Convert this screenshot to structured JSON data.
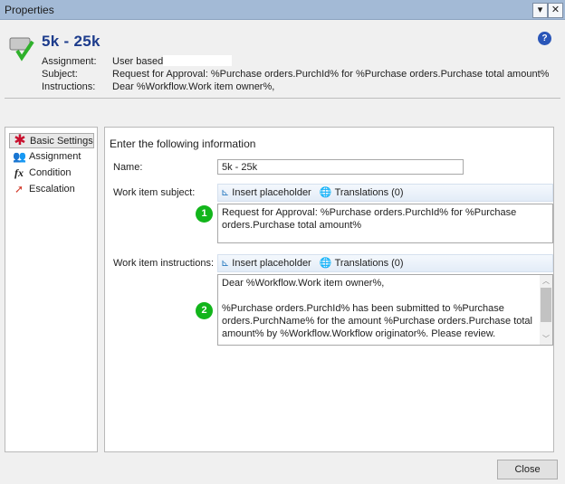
{
  "window": {
    "title": "Properties",
    "dropdown_icon": "▾",
    "close_icon": "✕"
  },
  "header": {
    "title": "5k  - 25k",
    "assignment_label": "Assignment:",
    "assignment_value": "User based:",
    "subject_label": "Subject:",
    "subject_value": "Request for Approval: %Purchase orders.PurchId% for %Purchase orders.Purchase total amount%",
    "instructions_label": "Instructions:",
    "instructions_value": "Dear %Workflow.Work item owner%,"
  },
  "nav": {
    "items": [
      {
        "label": "Basic Settings",
        "icon": "asterisk-icon",
        "selected": true
      },
      {
        "label": "Assignment",
        "icon": "users-icon"
      },
      {
        "label": "Condition",
        "icon": "fx-icon"
      },
      {
        "label": "Escalation",
        "icon": "escalation-icon"
      }
    ]
  },
  "form": {
    "heading": "Enter the following information",
    "name_label": "Name:",
    "name_value": "5k  - 25k",
    "subject_label": "Work item subject:",
    "instructions_label": "Work item instructions:",
    "insert_placeholder": "Insert placeholder",
    "translations": "Translations (0)",
    "subject_line1": "Request for Approval: %Purchase orders.PurchId% for %Purchase",
    "subject_line2": "orders.Purchase total amount%",
    "instr_line1": "Dear %Workflow.Work item owner%,",
    "instr_line2": "%Purchase orders.PurchId% has been submitted to %Purchase",
    "instr_line3": "orders.PurchName% for the amount %Purchase orders.Purchase total",
    "instr_line4": "amount% by %Workflow.Workflow originator%. Please review.",
    "badge1": "1",
    "badge2": "2"
  },
  "footer": {
    "close_label": "Close"
  }
}
